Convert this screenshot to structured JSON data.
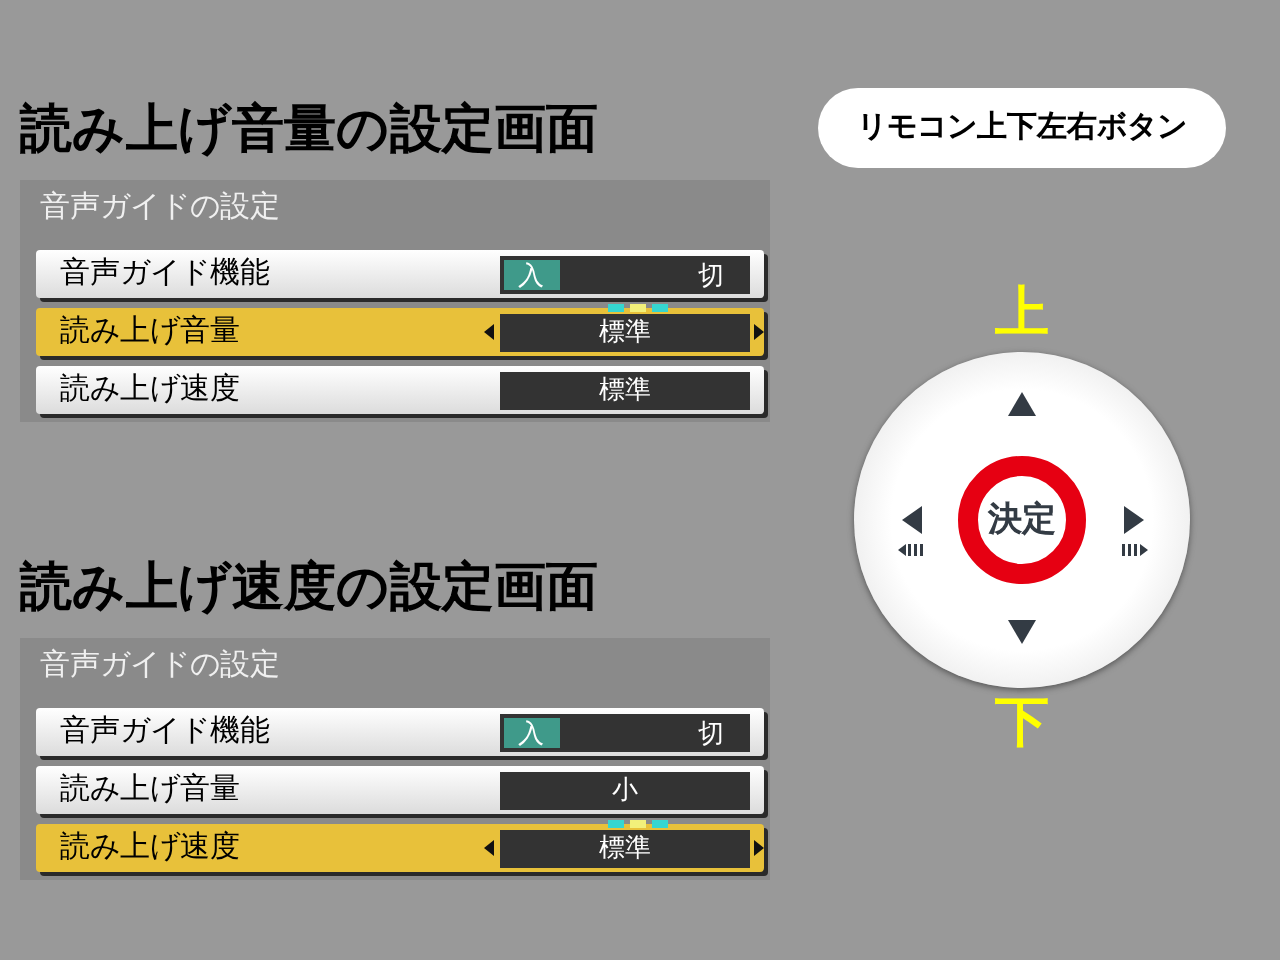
{
  "sections": [
    {
      "title": "読み上げ音量の設定画面",
      "panel": {
        "header": "音声ガイドの設定",
        "rows": [
          {
            "kind": "toggle",
            "label": "音声ガイド機能",
            "selected": false,
            "options": [
              {
                "label": "入",
                "on": true
              },
              {
                "label": "切",
                "on": false
              }
            ]
          },
          {
            "kind": "value",
            "label": "読み上げ音量",
            "selected": true,
            "value": "標準"
          },
          {
            "kind": "value",
            "label": "読み上げ速度",
            "selected": false,
            "value": "標準"
          }
        ]
      }
    },
    {
      "title": "読み上げ速度の設定画面",
      "panel": {
        "header": "音声ガイドの設定",
        "rows": [
          {
            "kind": "toggle",
            "label": "音声ガイド機能",
            "selected": false,
            "options": [
              {
                "label": "入",
                "on": true
              },
              {
                "label": "切",
                "on": false
              }
            ]
          },
          {
            "kind": "value",
            "label": "読み上げ音量",
            "selected": false,
            "value": "小"
          },
          {
            "kind": "value",
            "label": "読み上げ速度",
            "selected": true,
            "value": "標準"
          }
        ]
      }
    }
  ],
  "remote": {
    "caption": "リモコン上下左右ボタン",
    "up_label": "上",
    "center_label": "決定",
    "down_label": "下"
  }
}
